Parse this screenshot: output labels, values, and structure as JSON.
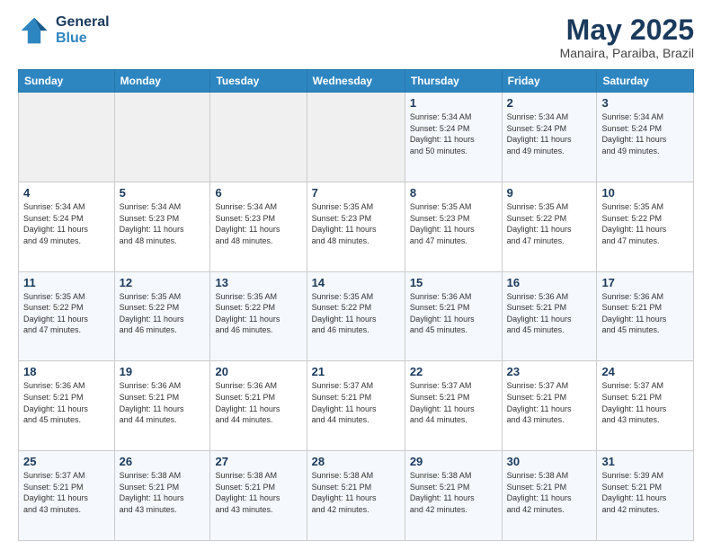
{
  "header": {
    "logo_line1": "General",
    "logo_line2": "Blue",
    "month_title": "May 2025",
    "location": "Manaira, Paraiba, Brazil"
  },
  "weekdays": [
    "Sunday",
    "Monday",
    "Tuesday",
    "Wednesday",
    "Thursday",
    "Friday",
    "Saturday"
  ],
  "weeks": [
    [
      {
        "day": "",
        "info": ""
      },
      {
        "day": "",
        "info": ""
      },
      {
        "day": "",
        "info": ""
      },
      {
        "day": "",
        "info": ""
      },
      {
        "day": "1",
        "info": "Sunrise: 5:34 AM\nSunset: 5:24 PM\nDaylight: 11 hours\nand 50 minutes."
      },
      {
        "day": "2",
        "info": "Sunrise: 5:34 AM\nSunset: 5:24 PM\nDaylight: 11 hours\nand 49 minutes."
      },
      {
        "day": "3",
        "info": "Sunrise: 5:34 AM\nSunset: 5:24 PM\nDaylight: 11 hours\nand 49 minutes."
      }
    ],
    [
      {
        "day": "4",
        "info": "Sunrise: 5:34 AM\nSunset: 5:24 PM\nDaylight: 11 hours\nand 49 minutes."
      },
      {
        "day": "5",
        "info": "Sunrise: 5:34 AM\nSunset: 5:23 PM\nDaylight: 11 hours\nand 48 minutes."
      },
      {
        "day": "6",
        "info": "Sunrise: 5:34 AM\nSunset: 5:23 PM\nDaylight: 11 hours\nand 48 minutes."
      },
      {
        "day": "7",
        "info": "Sunrise: 5:35 AM\nSunset: 5:23 PM\nDaylight: 11 hours\nand 48 minutes."
      },
      {
        "day": "8",
        "info": "Sunrise: 5:35 AM\nSunset: 5:23 PM\nDaylight: 11 hours\nand 47 minutes."
      },
      {
        "day": "9",
        "info": "Sunrise: 5:35 AM\nSunset: 5:22 PM\nDaylight: 11 hours\nand 47 minutes."
      },
      {
        "day": "10",
        "info": "Sunrise: 5:35 AM\nSunset: 5:22 PM\nDaylight: 11 hours\nand 47 minutes."
      }
    ],
    [
      {
        "day": "11",
        "info": "Sunrise: 5:35 AM\nSunset: 5:22 PM\nDaylight: 11 hours\nand 47 minutes."
      },
      {
        "day": "12",
        "info": "Sunrise: 5:35 AM\nSunset: 5:22 PM\nDaylight: 11 hours\nand 46 minutes."
      },
      {
        "day": "13",
        "info": "Sunrise: 5:35 AM\nSunset: 5:22 PM\nDaylight: 11 hours\nand 46 minutes."
      },
      {
        "day": "14",
        "info": "Sunrise: 5:35 AM\nSunset: 5:22 PM\nDaylight: 11 hours\nand 46 minutes."
      },
      {
        "day": "15",
        "info": "Sunrise: 5:36 AM\nSunset: 5:21 PM\nDaylight: 11 hours\nand 45 minutes."
      },
      {
        "day": "16",
        "info": "Sunrise: 5:36 AM\nSunset: 5:21 PM\nDaylight: 11 hours\nand 45 minutes."
      },
      {
        "day": "17",
        "info": "Sunrise: 5:36 AM\nSunset: 5:21 PM\nDaylight: 11 hours\nand 45 minutes."
      }
    ],
    [
      {
        "day": "18",
        "info": "Sunrise: 5:36 AM\nSunset: 5:21 PM\nDaylight: 11 hours\nand 45 minutes."
      },
      {
        "day": "19",
        "info": "Sunrise: 5:36 AM\nSunset: 5:21 PM\nDaylight: 11 hours\nand 44 minutes."
      },
      {
        "day": "20",
        "info": "Sunrise: 5:36 AM\nSunset: 5:21 PM\nDaylight: 11 hours\nand 44 minutes."
      },
      {
        "day": "21",
        "info": "Sunrise: 5:37 AM\nSunset: 5:21 PM\nDaylight: 11 hours\nand 44 minutes."
      },
      {
        "day": "22",
        "info": "Sunrise: 5:37 AM\nSunset: 5:21 PM\nDaylight: 11 hours\nand 44 minutes."
      },
      {
        "day": "23",
        "info": "Sunrise: 5:37 AM\nSunset: 5:21 PM\nDaylight: 11 hours\nand 43 minutes."
      },
      {
        "day": "24",
        "info": "Sunrise: 5:37 AM\nSunset: 5:21 PM\nDaylight: 11 hours\nand 43 minutes."
      }
    ],
    [
      {
        "day": "25",
        "info": "Sunrise: 5:37 AM\nSunset: 5:21 PM\nDaylight: 11 hours\nand 43 minutes."
      },
      {
        "day": "26",
        "info": "Sunrise: 5:38 AM\nSunset: 5:21 PM\nDaylight: 11 hours\nand 43 minutes."
      },
      {
        "day": "27",
        "info": "Sunrise: 5:38 AM\nSunset: 5:21 PM\nDaylight: 11 hours\nand 43 minutes."
      },
      {
        "day": "28",
        "info": "Sunrise: 5:38 AM\nSunset: 5:21 PM\nDaylight: 11 hours\nand 42 minutes."
      },
      {
        "day": "29",
        "info": "Sunrise: 5:38 AM\nSunset: 5:21 PM\nDaylight: 11 hours\nand 42 minutes."
      },
      {
        "day": "30",
        "info": "Sunrise: 5:38 AM\nSunset: 5:21 PM\nDaylight: 11 hours\nand 42 minutes."
      },
      {
        "day": "31",
        "info": "Sunrise: 5:39 AM\nSunset: 5:21 PM\nDaylight: 11 hours\nand 42 minutes."
      }
    ]
  ]
}
